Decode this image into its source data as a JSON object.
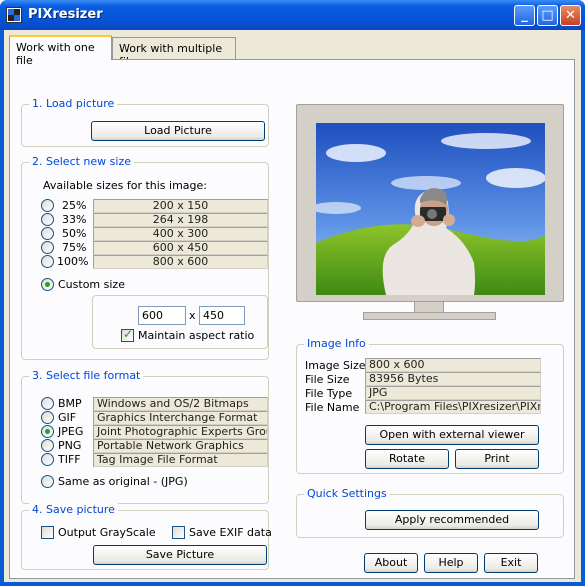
{
  "window": {
    "title": "PIXresizer",
    "minimize": "_",
    "maximize": "□",
    "close": "✕"
  },
  "tabs": [
    {
      "label": "Work with one file"
    },
    {
      "label": "Work with multiple files"
    }
  ],
  "load": {
    "title": "1. Load picture",
    "button": "Load Picture"
  },
  "size": {
    "title": "2. Select new size",
    "available_label": "Available sizes for this image:",
    "options": [
      {
        "pct": "25%",
        "dims": "200 x 150"
      },
      {
        "pct": "33%",
        "dims": "264 x 198"
      },
      {
        "pct": "50%",
        "dims": "400 x 300"
      },
      {
        "pct": "75%",
        "dims": "600 x 450"
      },
      {
        "pct": "100%",
        "dims": "800 x 600"
      }
    ],
    "custom_label": "Custom size",
    "custom_width": "600",
    "times": "x",
    "custom_height": "450",
    "maintain_label": "Maintain aspect ratio"
  },
  "format": {
    "title": "3. Select file format",
    "options": [
      {
        "name": "BMP",
        "desc": "Windows and OS/2 Bitmaps"
      },
      {
        "name": "GIF",
        "desc": "Graphics Interchange Format"
      },
      {
        "name": "JPEG",
        "desc": "Joint Photographic Experts Group"
      },
      {
        "name": "PNG",
        "desc": "Portable Network Graphics"
      },
      {
        "name": "TIFF",
        "desc": "Tag Image File Format"
      }
    ],
    "same_label": "Same as original  - (JPG)"
  },
  "save": {
    "title": "4. Save picture",
    "grayscale_label": "Output GrayScale",
    "exif_label": "Save EXIF data",
    "button": "Save Picture"
  },
  "info": {
    "title": "Image Info",
    "rows": [
      {
        "label": "Image Size",
        "value": "800 x 600"
      },
      {
        "label": "File Size",
        "value": "83956 Bytes"
      },
      {
        "label": "File Type",
        "value": "JPG"
      },
      {
        "label": "File Name",
        "value": "C:\\Program Files\\PIXresizer\\PIXresiz"
      }
    ],
    "open_button": "Open with external viewer",
    "rotate_button": "Rotate",
    "print_button": "Print"
  },
  "quick": {
    "title": "Quick Settings",
    "button": "Apply recommended"
  },
  "footer": {
    "about": "About",
    "help": "Help",
    "exit": "Exit"
  },
  "colors": {
    "titlebar": "#0552d6",
    "group_title": "#0046d5",
    "radio_dot": "#21a121"
  }
}
